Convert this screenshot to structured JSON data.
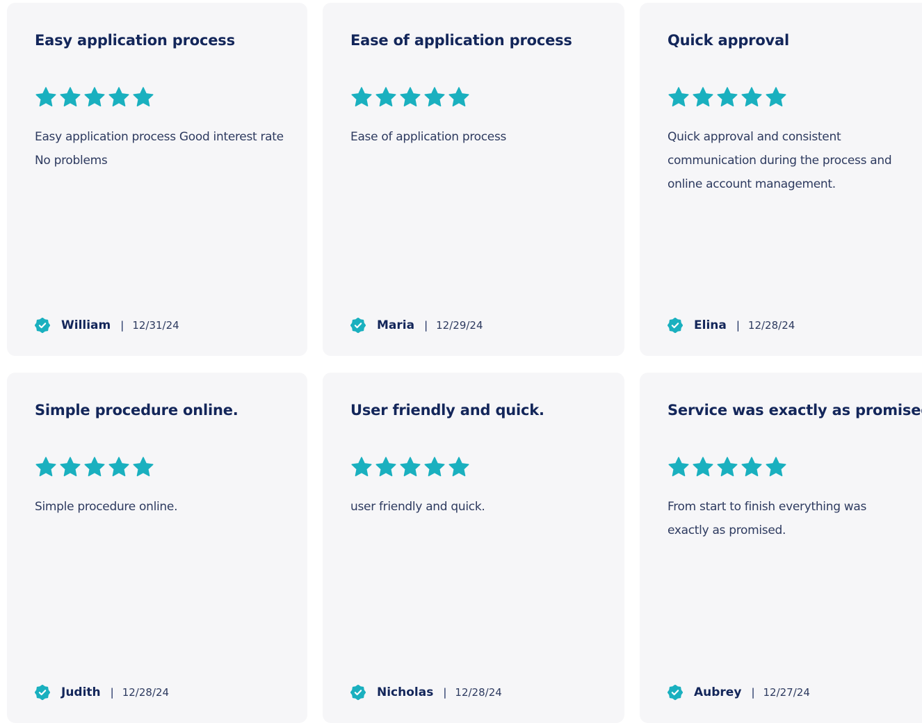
{
  "colors": {
    "card_background": "#f6f6f8",
    "star_color": "#1ab0bf",
    "title_color": "#13265a",
    "body_color": "#2d3a5f",
    "verified_badge_color": "#1ab0bf"
  },
  "reviews": [
    {
      "title": "Easy application process",
      "rating": 5,
      "body": "Easy application process Good interest rate No problems",
      "author": "William",
      "date": "12/31/24",
      "verified_icon": "verified-badge-icon"
    },
    {
      "title": "Ease of application process",
      "rating": 5,
      "body": "Ease of application process",
      "author": "Maria",
      "date": "12/29/24",
      "verified_icon": "verified-badge-icon"
    },
    {
      "title": "Quick approval",
      "rating": 5,
      "body": "Quick approval and consistent communication during the process and online account management.",
      "author": "Elina",
      "date": "12/28/24",
      "verified_icon": "verified-badge-icon"
    },
    {
      "title": "Simple procedure online.",
      "rating": 5,
      "body": "Simple procedure online.",
      "author": "Judith",
      "date": "12/28/24",
      "verified_icon": "verified-badge-icon"
    },
    {
      "title": "User friendly and quick.",
      "rating": 5,
      "body": "user friendly and quick.",
      "author": "Nicholas",
      "date": "12/28/24",
      "verified_icon": "verified-badge-icon"
    },
    {
      "title": "Service was exactly as promised",
      "rating": 5,
      "body": "From start to finish everything was exactly as promised.",
      "author": "Aubrey",
      "date": "12/27/24",
      "verified_icon": "verified-badge-icon"
    }
  ],
  "separator": "|"
}
